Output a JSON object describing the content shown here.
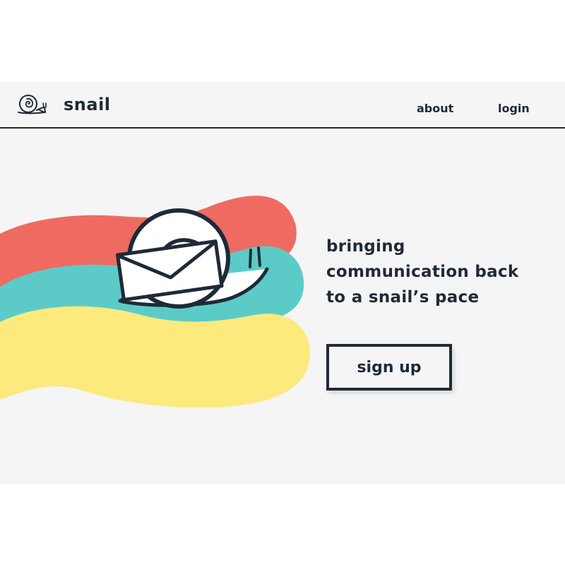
{
  "header": {
    "logo_icon": "snail-icon",
    "brand": "snail",
    "nav": [
      {
        "label": "about"
      },
      {
        "label": "login"
      }
    ]
  },
  "hero": {
    "tagline_lines": [
      "bringing",
      "communication back",
      "to a snail’s pace"
    ],
    "cta_label": "sign up",
    "illustration_icons": [
      "snail-icon",
      "envelope-icon"
    ]
  },
  "colors": {
    "ink": "#1e2a38",
    "background": "#f5f5f5",
    "coral": "#ef6b61",
    "teal": "#5ccbc8",
    "yellow": "#fcea7d"
  }
}
